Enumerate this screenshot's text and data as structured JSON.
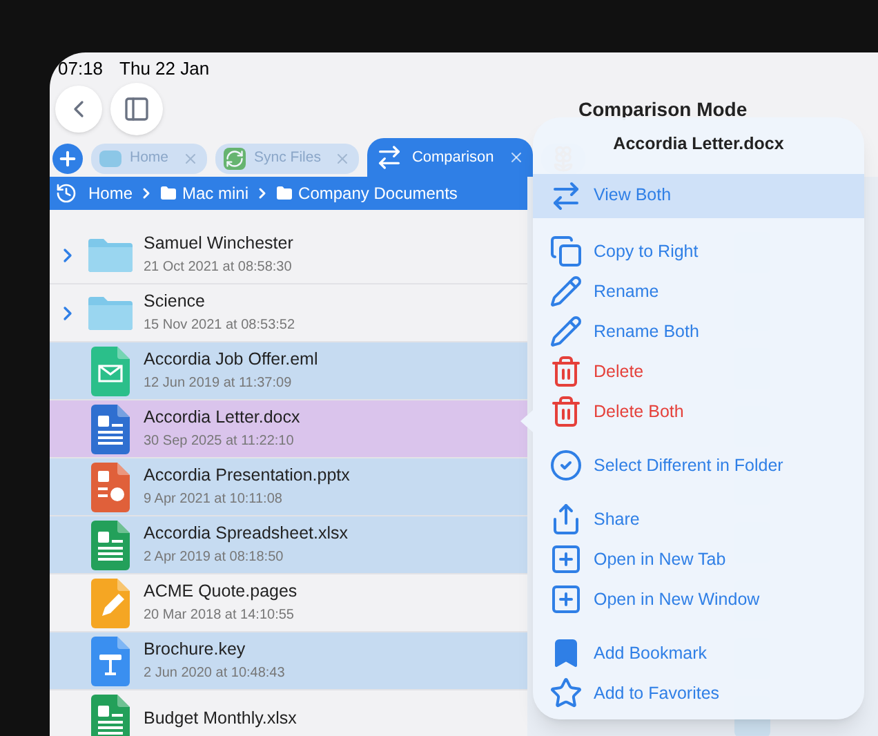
{
  "status_bar": {
    "time": "07:18",
    "date": "Thu 22 Jan"
  },
  "title": "Comparison Mode",
  "tabs": [
    {
      "label": "Home",
      "kind": "folder",
      "selected": false
    },
    {
      "label": "Sync Files",
      "kind": "sync",
      "selected": false
    },
    {
      "label": "Comparison",
      "kind": "compare",
      "selected": true
    },
    {
      "kind": "photos",
      "selected": false
    }
  ],
  "breadcrumb": [
    "Home",
    "Mac mini",
    "Company Documents"
  ],
  "files": [
    {
      "name": "Samuel Winchester",
      "date": "21 Oct 2021 at 08:58:30",
      "kind": "folder",
      "expandable": true,
      "selected": false,
      "focused": false
    },
    {
      "name": "Science",
      "date": "15 Nov 2021 at 08:53:52",
      "kind": "folder",
      "expandable": true,
      "selected": false,
      "focused": false
    },
    {
      "name": "Accordia Job Offer.eml",
      "date": "12 Jun 2019 at 11:37:09",
      "kind": "eml",
      "expandable": false,
      "selected": true,
      "focused": false
    },
    {
      "name": "Accordia Letter.docx",
      "date": "30 Sep 2025 at 11:22:10",
      "kind": "docx",
      "expandable": false,
      "selected": true,
      "focused": true
    },
    {
      "name": "Accordia Presentation.pptx",
      "date": "9 Apr 2021 at 10:11:08",
      "kind": "pptx",
      "expandable": false,
      "selected": true,
      "focused": false
    },
    {
      "name": "Accordia Spreadsheet.xlsx",
      "date": "2 Apr 2019 at 08:18:50",
      "kind": "xlsx",
      "expandable": false,
      "selected": true,
      "focused": false
    },
    {
      "name": "ACME Quote.pages",
      "date": "20 Mar 2018 at 14:10:55",
      "kind": "pages",
      "expandable": false,
      "selected": false,
      "focused": false
    },
    {
      "name": "Brochure.key",
      "date": "2 Jun 2020 at 10:48:43",
      "kind": "key",
      "expandable": false,
      "selected": true,
      "focused": false
    },
    {
      "name": "Budget Monthly.xlsx",
      "kind": "xlsx",
      "expandable": false,
      "selected": false,
      "focused": false
    }
  ],
  "menu": {
    "title": "Accordia Letter.docx",
    "groups": [
      [
        {
          "label": "View Both",
          "kind": "compare",
          "destructive": false,
          "highlighted": true
        }
      ],
      [
        {
          "label": "Copy to Right",
          "kind": "copy",
          "destructive": false,
          "highlighted": false
        },
        {
          "label": "Rename",
          "kind": "pencil",
          "destructive": false,
          "highlighted": false
        },
        {
          "label": "Rename Both",
          "kind": "pencil",
          "destructive": false,
          "highlighted": false
        },
        {
          "label": "Delete",
          "kind": "trash",
          "destructive": true,
          "highlighted": false
        },
        {
          "label": "Delete Both",
          "kind": "trash",
          "destructive": true,
          "highlighted": false
        }
      ],
      [
        {
          "label": "Select Different in Folder",
          "kind": "select",
          "destructive": false,
          "highlighted": false
        }
      ],
      [
        {
          "label": "Share",
          "kind": "share",
          "destructive": false,
          "highlighted": false
        },
        {
          "label": "Open in New Tab",
          "kind": "newtab",
          "destructive": false,
          "highlighted": false
        },
        {
          "label": "Open in New Window",
          "kind": "newwindow",
          "destructive": false,
          "highlighted": false
        }
      ],
      [
        {
          "label": "Add Bookmark",
          "kind": "bookmark",
          "destructive": false,
          "highlighted": false
        },
        {
          "label": "Add to Favorites",
          "kind": "star",
          "destructive": false,
          "highlighted": false
        }
      ]
    ]
  }
}
